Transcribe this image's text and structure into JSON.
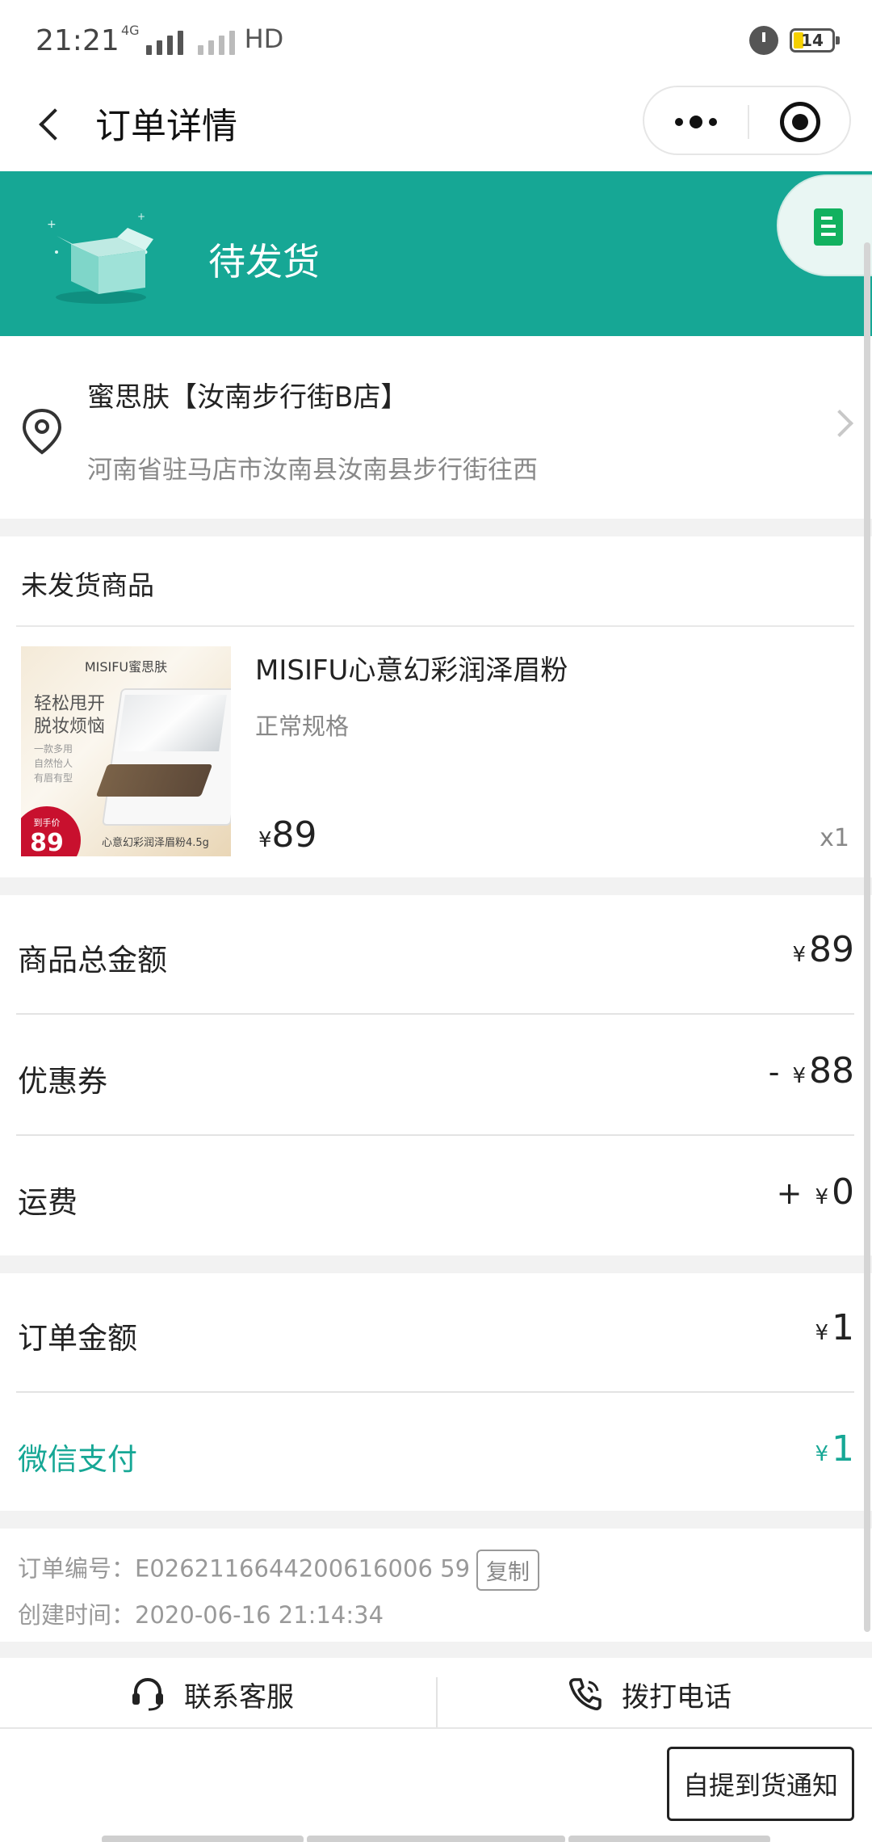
{
  "status_bar": {
    "time": "21:21",
    "network_label": "4G",
    "hd_label": "HD",
    "battery": "14"
  },
  "nav": {
    "title": "订单详情"
  },
  "banner": {
    "status": "待发货",
    "color": "#16a795"
  },
  "address": {
    "store_name": "蜜思肤【汝南步行街B店】",
    "detail": "河南省驻马店市汝南县汝南县步行街往西"
  },
  "products": {
    "header": "未发货商品",
    "items": [
      {
        "image_brand": "MISIFU蜜思肤",
        "image_slogan_1": "轻松甩开",
        "image_slogan_2": "脱妆烦恼",
        "image_bullets": [
          "一款多用",
          "自然怡人",
          "有眉有型"
        ],
        "image_badge_label": "到手价",
        "image_badge_price": "89",
        "image_caption": "心意幻彩润泽眉粉4.5g",
        "name": "MISIFU心意幻彩润泽眉粉",
        "spec": "正常规格",
        "currency": "¥",
        "price": "89",
        "quantity": "x1"
      }
    ]
  },
  "amounts": {
    "subtotal": {
      "label": "商品总金额",
      "sign": "",
      "currency": "¥",
      "value": "89"
    },
    "coupon": {
      "label": "优惠券",
      "sign": "-",
      "currency": "¥",
      "value": "88"
    },
    "shipping": {
      "label": "运费",
      "sign": "+",
      "currency": "¥",
      "value": "0"
    }
  },
  "totals": {
    "order_amount": {
      "label": "订单金额",
      "currency": "¥",
      "value": "1"
    },
    "wechat_pay": {
      "label": "微信支付",
      "currency": "¥",
      "value": "1"
    }
  },
  "order_info": {
    "order_no_label": "订单编号：",
    "order_no": "E0262116644200616006 59",
    "copy_label": "复制",
    "created_label": "创建时间：",
    "created_at": "2020-06-16 21:14:34"
  },
  "contact": {
    "service_label": "联系客服",
    "call_label": "拨打电话"
  },
  "bottom": {
    "notify_label": "自提到货通知"
  },
  "accent_colors": {
    "primary": "#16a795",
    "float_icon": "#12b15f"
  }
}
